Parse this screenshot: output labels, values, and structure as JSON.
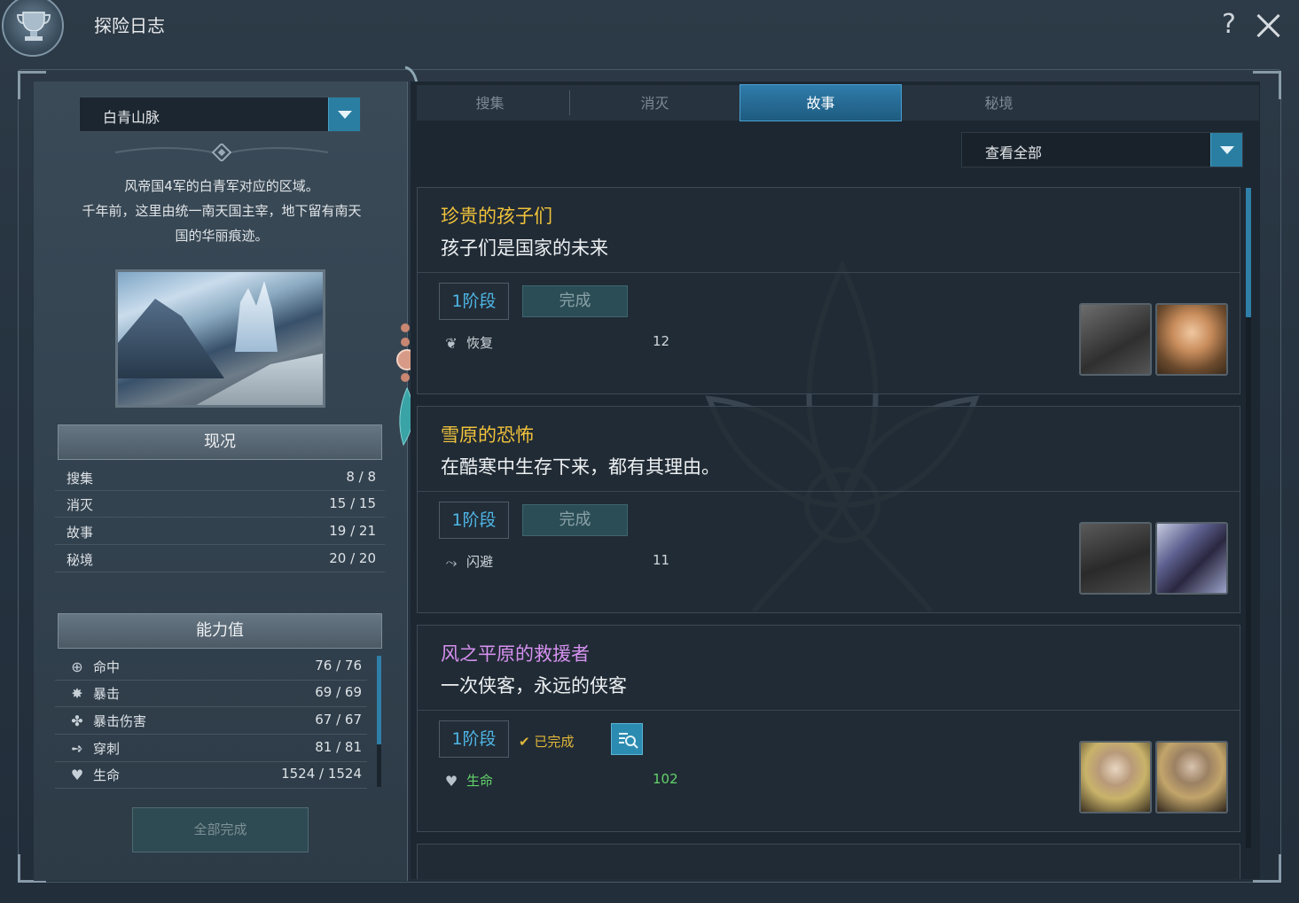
{
  "window": {
    "title": "探险日志",
    "help_label": "?"
  },
  "region": {
    "selected": "白青山脉",
    "description_lines": [
      "风帝国4军的白青军对应的区域。",
      "千年前，这里由统一南天国主宰，地下留有南天",
      "国的华丽痕迹。"
    ]
  },
  "status": {
    "title": "现况",
    "rows": [
      {
        "label": "搜集",
        "value": "8 / 8"
      },
      {
        "label": "消灭",
        "value": "15 / 15"
      },
      {
        "label": "故事",
        "value": "19 / 21"
      },
      {
        "label": "秘境",
        "value": "20 / 20"
      }
    ]
  },
  "abilities": {
    "title": "能力值",
    "rows": [
      {
        "icon": "accuracy-icon",
        "label": "命中",
        "value": "76 / 76"
      },
      {
        "icon": "critical-icon",
        "label": "暴击",
        "value": "69 / 69"
      },
      {
        "icon": "critical-damage-icon",
        "label": "暴击伤害",
        "value": "67 / 67"
      },
      {
        "icon": "pierce-icon",
        "label": "穿刺",
        "value": "81 / 81"
      },
      {
        "icon": "heart-icon",
        "label": "生命",
        "value": "1524 / 1524"
      }
    ]
  },
  "complete_all_label": "全部完成",
  "tabs": [
    "搜集",
    "消灭",
    "故事",
    "秘境"
  ],
  "active_tab": "故事",
  "filter": {
    "selected": "查看全部"
  },
  "quests": [
    {
      "name": "珍贵的孩子们",
      "name_color": "#f0c23b",
      "subtitle": "孩子们是国家的未来",
      "stage": "1阶段",
      "state": "完成",
      "reward_icon": "recovery-icon",
      "reward_label": "恢复",
      "reward_value": "12",
      "reward_color": "#d0d6db"
    },
    {
      "name": "雪原的恐怖",
      "name_color": "#f0c23b",
      "subtitle": "在酷寒中生存下来，都有其理由。",
      "stage": "1阶段",
      "state": "完成",
      "reward_icon": "evasion-icon",
      "reward_label": "闪避",
      "reward_value": "11",
      "reward_color": "#d0d6db"
    },
    {
      "name": "风之平原的救援者",
      "name_color": "#d691f0",
      "subtitle": "一次侠客，永远的侠客",
      "stage": "1阶段",
      "state": "已完成",
      "reward_icon": "heart-icon",
      "reward_label": "生命",
      "reward_value": "102",
      "reward_color": "#63d36a"
    }
  ]
}
